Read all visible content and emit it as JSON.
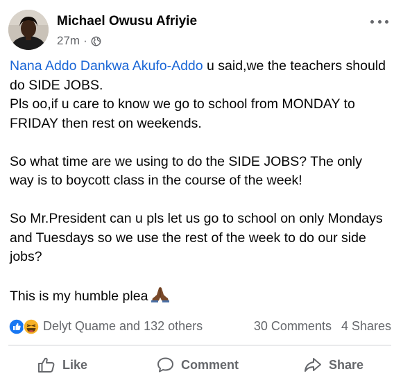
{
  "post": {
    "author": "Michael Owusu Afriyie",
    "time": "27m",
    "separator": "·",
    "privacy_icon": "globe-icon",
    "mention": "Nana Addo Dankwa Akufo-Addo",
    "paragraph1_rest": " u said,we the teachers should do SIDE JOBS.",
    "paragraph1_line2": "Pls oo,if u care to know we go to school from MONDAY to FRIDAY then rest on weekends.",
    "paragraph2": "So what time are we using to do the SIDE JOBS? The only way is to boycott class in the course of the week!",
    "paragraph3": "So Mr.President can u pls let us go to school on only Mondays and Tuesdays so we use the rest of the week to do our side jobs?",
    "paragraph4": "This is my humble plea",
    "emoji": "folded-hands"
  },
  "stats": {
    "reactions_text": "Delyt Quame and 132 others",
    "reaction_icons": [
      "like-reaction-icon",
      "haha-reaction-icon"
    ],
    "comments": "30 Comments",
    "shares": "4 Shares"
  },
  "actions": {
    "like": "Like",
    "comment": "Comment",
    "share": "Share"
  },
  "colors": {
    "mention": "#1a66d6",
    "secondary_text": "#65676b",
    "like_blue": "#1877f2",
    "haha_yellow": "#f7b125"
  }
}
